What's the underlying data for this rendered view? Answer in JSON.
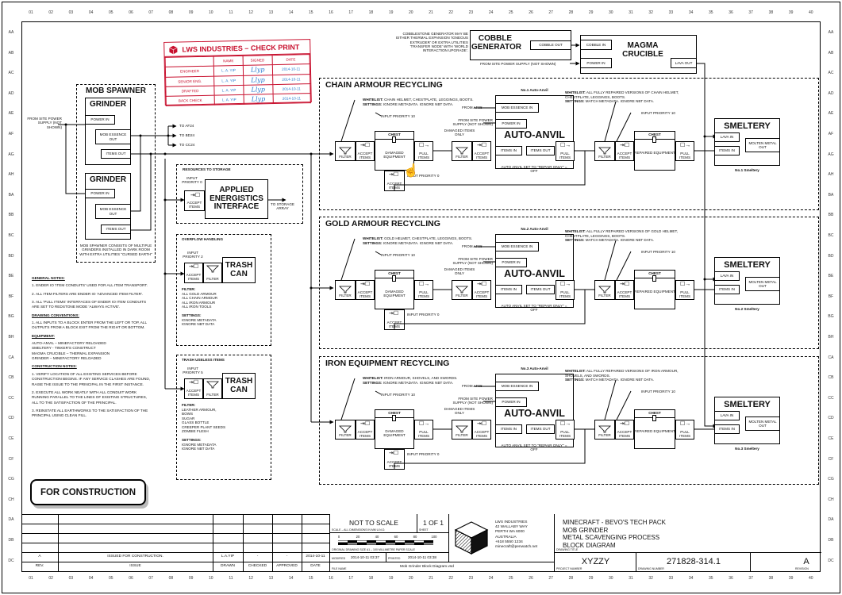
{
  "grid": {
    "columns": [
      "01",
      "02",
      "03",
      "04",
      "05",
      "06",
      "07",
      "08",
      "09",
      "10",
      "11",
      "12",
      "13",
      "14",
      "15",
      "16",
      "17",
      "18",
      "19",
      "20",
      "21",
      "22",
      "23",
      "24",
      "25",
      "26",
      "27",
      "28",
      "29",
      "30",
      "31",
      "32",
      "33",
      "34",
      "35",
      "36",
      "37",
      "38",
      "39",
      "40"
    ],
    "rows": [
      "AA",
      "AB",
      "AC",
      "AD",
      "AE",
      "AF",
      "AG",
      "AH",
      "BA",
      "BB",
      "BC",
      "BD",
      "BE",
      "BF",
      "BG",
      "BH",
      "CA",
      "CB",
      "CC",
      "CD",
      "CE",
      "CF",
      "CG",
      "CH",
      "DA",
      "DB",
      "DC"
    ]
  },
  "check_print": {
    "title": "LWS INDUSTRIES – CHECK PRINT",
    "headers": [
      "",
      "NAME",
      "SIGNED",
      "DATE"
    ],
    "rows": [
      {
        "role": "ENGINEER",
        "name": "L. A. YIP",
        "signed": "Llyp",
        "date": "2014-10-11"
      },
      {
        "role": "SENIOR ENG.",
        "name": "L. A. YIP",
        "signed": "Llyp",
        "date": "2014-10-11"
      },
      {
        "role": "DRAFTED",
        "name": "L. A. YIP",
        "signed": "Llyp",
        "date": "2014-10-11"
      },
      {
        "role": "BACK CHECK",
        "name": "L. A. YIP",
        "signed": "Llyp",
        "date": "2014-10-11"
      }
    ],
    "color": "#c8102e",
    "ink_color": "#2b7bd0"
  },
  "cobble": {
    "note": "COBBLESTONE GENERATOR MAY BE EITHER THERMAL EXPANSION 'IGNEOUS EXTRUDER' OR EXTRA UTILITIES 'TRANSFER NODE' WITH 'WORLD INTERACTION UPGRADE'.",
    "generator_title": "COBBLE GENERATOR",
    "cobble_out": "COBBLE OUT",
    "crucible_title": "MAGMA CRUCIBLE",
    "cobble_in": "COBBLE IN",
    "power_in": "POWER IN",
    "lava_out": "LAVA OUT",
    "power_source": "FROM SITE POWER SUPPLY (NOT SHOWN)"
  },
  "mob_spawner": {
    "title": "MOB SPAWNER",
    "power_source": "FROM SITE POWER SUPPLY (NOT SHOWN)",
    "grinder_title": "GRINDER",
    "power_in": "POWER IN",
    "mob_essence_out": "MOB ESSENCE OUT",
    "items_out": "ITEMS OUT",
    "note": "MOB SPAWNER CONSISTS OF MULTIPLE GRINDERS INSTALLED IN DARK ROOM WITH EXTRA UTILITIES \"CURSED EARTH\"",
    "targets": [
      "TO AF24",
      "TO BD24",
      "TO CC24"
    ]
  },
  "storage": {
    "section": "RESOURCES TO STORAGE",
    "priority": "INPUT PRIORITY 0",
    "accept": "ACCEPT ITEMS",
    "title": "APPLIED ENERGISTICS INTERFACE",
    "dest": "TO STORAGE ARRAY"
  },
  "overflow": {
    "section": "OVERFLOW HANDLING",
    "priority": "INPUT PRIORITY 2",
    "accept": "ACCEPT ITEMS",
    "filter": "FILTER",
    "title": "TRASH CAN",
    "filter_head": "FILTER:",
    "filter_items": [
      "ALL GOLD ARMOUR",
      "ALL CHAIN ARMOUR",
      "ALL IRON ARMOUR",
      "ALL IRON TOOLS"
    ],
    "settings_head": "SETTINGS:",
    "settings_items": [
      "IGNORE METADATA",
      "IGNORE NBT DATA"
    ]
  },
  "trash": {
    "section": "TRASH USELESS ITEMS",
    "priority": "INPUT PRIORITY 5",
    "accept": "ACCEPT ITEMS",
    "filter": "FILTER",
    "title": "TRASH CAN",
    "filter_head": "FILTER:",
    "filter_items": [
      "LEATHER ARMOUR,",
      "BOWS",
      "SUGAR",
      "GLASS BOTTLE",
      "CREEPER PLANT SEEDS",
      "ZOMBIE FLESH"
    ],
    "settings_head": "SETTINGS:",
    "settings_items": [
      "IGNORE METADATA",
      "IGNORE NBT DATA"
    ]
  },
  "labels": {
    "filter": "FILTER",
    "accept_items": "ACCEPT ITEMS",
    "pull_items": "PULL ITEMS",
    "chest": "CHEST",
    "damaged_equipment": "DAMAGED EQUIPMENT",
    "repaired_equipment": "REPAIRED EQUIPMENT",
    "input_priority_10": "INPUT PRIORITY 10",
    "input_priority_0": "INPUT PRIORITY 0",
    "from_af08": "FROM AF08",
    "from_site_power": "FROM SITE POWER SUPPLY (NOT SHOWN)",
    "damaged_items_only": "DAMAGED ITEMS ONLY",
    "mob_essence_in": "MOB ESSENCE IN",
    "power_in": "POWER IN",
    "auto_anvil": "AUTO-ANVIL",
    "items_in": "ITEMS IN",
    "items_out": "ITEMS OUT",
    "anvil_note": "AUTO ANVIL SET TO \"REPAIR ONLY\" = OFF",
    "smeltery": "SMELTERY",
    "lava_in": "LAVA IN",
    "molten_metal_out": "MOLTEN METAL OUT",
    "whitelist": "WHITELIST:",
    "settings": "SETTINGS:"
  },
  "sections": [
    {
      "title": "CHAIN ARMOUR RECYCLING",
      "whitelist_in": "CHAIN HELMET, CHESTPLATE, LEGGINGS, BOOTS.",
      "settings_in": "IGNORE METADATA. IGNORE NBT DATA.",
      "anvil_name": "No.1 Auto-Anvil",
      "whitelist_out": "ALL FULLY REPAIRED VERSIONS OF CHAIN HELMET, CHESTPLATE, LEGGINGS, BOOTS.",
      "settings_out": "MATCH METADATA. IGNORE NBT DATA.",
      "smeltery_name": "No.1 Smeltery"
    },
    {
      "title": "GOLD ARMOUR RECYCLING",
      "whitelist_in": "GOLD HELMET, CHESTPLATE, LEGGINGS, BOOTS.",
      "settings_in": "IGNORE METADATA. IGNORE NBT DATA.",
      "anvil_name": "No.2 Auto-Anvil",
      "whitelist_out": "ALL FULLY REPAIRED VERSIONS OF GOLD HELMET, CHESTPLATE, LEGGINGS, BOOTS.",
      "settings_out": "MATCH METADATA. IGNORE NBT DATA.",
      "smeltery_name": "No.2 Smeltery"
    },
    {
      "title": "IRON EQUIPMENT RECYCLING",
      "whitelist_in": "IRON ARMOUR, SHOVELS, AND SWORDS.",
      "settings_in": "IGNORE METADATA. IGNORE NBT DATA.",
      "anvil_name": "No.3 Auto-Anvil",
      "whitelist_out": "ALL FULLY REPAIRED VERSIONS OF IRON ARMOUR, SHOVELS, AND SWORDS.",
      "settings_out": "MATCH METADATA. IGNORE NBT DATA.",
      "smeltery_name": "No.3 Smeltery"
    }
  ],
  "notes": {
    "general_head": "GENERAL NOTES:",
    "general": [
      "1. ENDER IO 'ITEM CONDUITS' USED FOR ALL ITEM TRANSPORT.",
      "2. ALL ITEM FILTERS ARE ENDER IO 'ADVANCED ITEM FILTER'.",
      "3. ALL 'PULL ITEMS' INTERFACES OF ENDER IO ITEM CONDUITS ARE SET TO REDSTONE MODE 'ALWAYS ACTIVE'."
    ],
    "conventions_head": "DRAWING CONVENTIONS:",
    "conventions": [
      "1. ALL INPUTS TO A BLOCK ENTER FROM THE LEFT OR TOP, ALL OUTPUTS FROM A BLOCK EXIT FROM THE RIGHT OR BOTTOM."
    ],
    "equipment_head": "EQUIPMENT:",
    "equipment": [
      "AUTO-ANVIL – MINEFACTORY RELOADED",
      "SMELTERY - TINKER'S CONSTRUCT",
      "MAGMA CRUCIBLE – THERMAL EXPANSION",
      "GRINDER – MINEFACTORY RELOADED"
    ],
    "construction_head": "CONSTRUCTION NOTES:",
    "construction": [
      "1. VERIFY LOCATION OF ALL EXISTING SERVICES BEFORE CONSTRUCTION BEGINS. IF ANY SERVICE CLASHES ARE FOUND, RAISE THE ISSUE TO THE PRINCIPAL IN THE FIRST INSTANCE.",
      "2. EXECUTE ALL WORK NEATLY WITH ALL CONDUIT WORK RUNNING PARALLEL TO THE LINES OF EXISTING STRUCTURES, ALL TO THE SATISFACTION OF THE PRINCIPAL.",
      "3. REINSTATE ALL EARTHWORKS TO THE SATISFACTION OF THE PRINCIPAL USING CLEAN FILL."
    ],
    "stamp": "FOR CONSTRUCTION"
  },
  "revisions": {
    "headers": [
      "REV.",
      "ISSUE",
      "DRAWN",
      "CHECKED",
      "APPROVED",
      "DATE"
    ],
    "rows": [
      {
        "rev": "A",
        "issue": "ISSUED FOR CONSTRUCTION.",
        "drawn": "L.A.YIP",
        "checked": "-",
        "approved": "-",
        "date": "2014-10-11"
      }
    ]
  },
  "title_block": {
    "scale": "NOT TO SCALE",
    "scale_label": "SCALE – ALL DIMENSIONS IN MM U.N.O.",
    "sheet": "1 OF 1",
    "sheet_label": "SHEET",
    "scale_ticks": [
      "0",
      "20",
      "40",
      "60",
      "80",
      "100"
    ],
    "paper_label": "ORIGINAL DRAWING SIZE A1 – 100 MILLIMETRE PAPER SCALE",
    "modified_label": "MODIFIED",
    "modified": "2014-10-11 03:37",
    "printed_label": "PRINTED",
    "printed": "2014-10-11 03:38",
    "filename_label": "FILE NAME",
    "filename": "Mob Grinder Block Diagram.vsd",
    "company": [
      "LWS INDUSTRIES",
      "42 WALLABY WAY",
      "PERTH WA 6000",
      "AUSTRALIA",
      "+618 5550 1234",
      "minecraft@penwatch.net"
    ],
    "drawing_title": [
      "MINECRAFT - BEVO'S TECH PACK",
      "MOB GRINDER",
      "METAL SCAVENGING PROCESS",
      "BLOCK DIAGRAM"
    ],
    "drawing_title_label": "DRAWING TITLE",
    "project_number": "XYZZY",
    "project_number_label": "PROJECT NUMBER",
    "drawing_number": "271828-314.1",
    "drawing_number_label": "DRAWING NUMBER",
    "revision": "A",
    "revision_label": "REVISION"
  }
}
